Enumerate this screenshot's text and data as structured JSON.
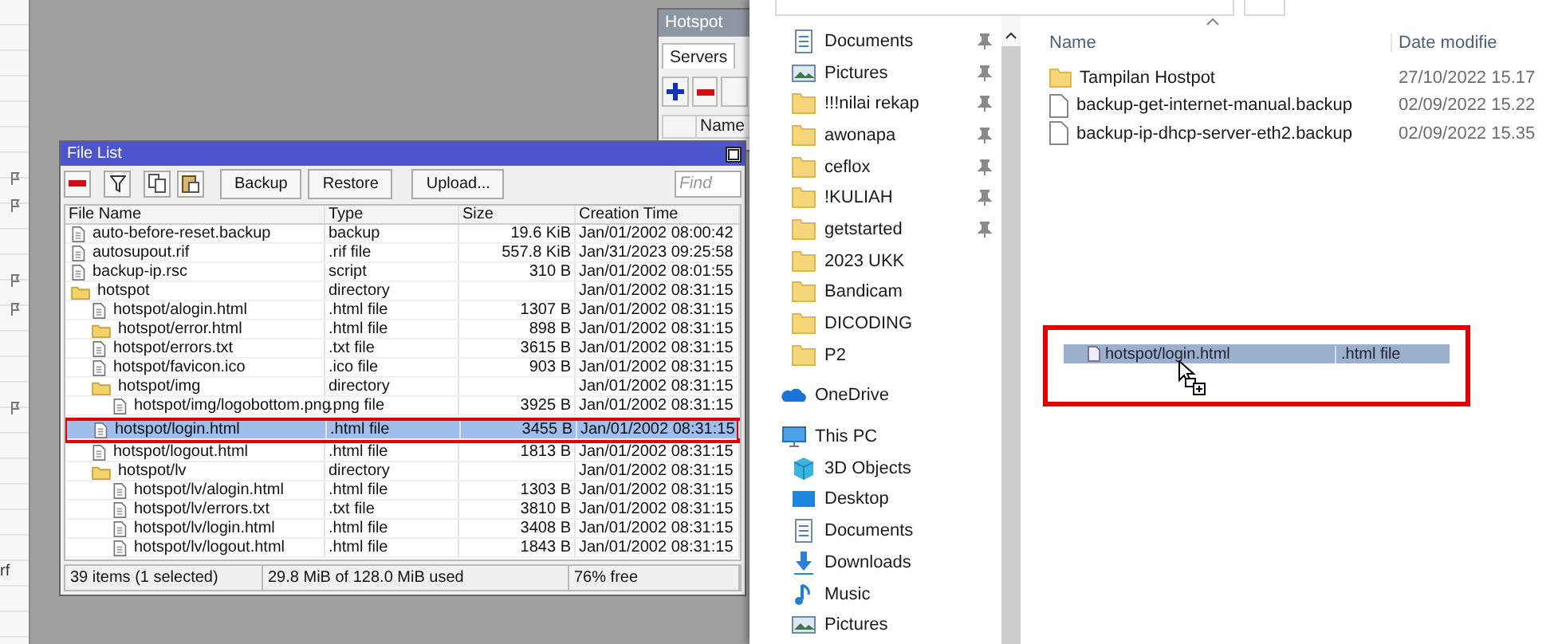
{
  "winbox": {
    "side_strip": {
      "fragment": "rf"
    },
    "hotspot_window": {
      "title": "Hotspot",
      "tabs": [
        {
          "label": "Servers",
          "selected": true
        }
      ],
      "columns": [
        "Name"
      ]
    },
    "file_list": {
      "title": "File List",
      "buttons": [
        "Backup",
        "Restore",
        "Upload..."
      ],
      "find": {
        "placeholder": "Find"
      },
      "columns": [
        "File Name",
        "Type",
        "Size",
        "Creation Time"
      ],
      "rows": [
        {
          "kind": "file",
          "name": "auto-before-reset.backup",
          "type": "backup",
          "size": "19.6 KiB",
          "created": "Jan/01/2002 08:00:42",
          "selected": false
        },
        {
          "kind": "file",
          "name": "autosupout.rif",
          "type": ".rif file",
          "size": "557.8 KiB",
          "created": "Jan/31/2023 09:25:58",
          "selected": false
        },
        {
          "kind": "file",
          "name": "backup-ip.rsc",
          "type": "script",
          "size": "310 B",
          "created": "Jan/01/2002 08:01:55",
          "selected": false
        },
        {
          "kind": "folder",
          "name": "hotspot",
          "type": "directory",
          "created": "Jan/01/2002 08:31:15",
          "selected": false,
          "children": [
            {
              "kind": "file",
              "name": "hotspot/alogin.html",
              "type": ".html file",
              "size": "1307 B",
              "created": "Jan/01/2002 08:31:15",
              "selected": false
            },
            {
              "kind": "folder",
              "name": "hotspot/error.html",
              "type": ".html file",
              "size": "898 B",
              "created": "Jan/01/2002 08:31:15",
              "selected": false
            },
            {
              "kind": "file",
              "name": "hotspot/errors.txt",
              "type": ".txt file",
              "size": "3615 B",
              "created": "Jan/01/2002 08:31:15",
              "selected": false
            },
            {
              "kind": "file",
              "name": "hotspot/favicon.ico",
              "type": ".ico file",
              "size": "903 B",
              "created": "Jan/01/2002 08:31:15",
              "selected": false
            },
            {
              "kind": "folder",
              "name": "hotspot/img",
              "type": "directory",
              "created": "Jan/01/2002 08:31:15",
              "selected": false,
              "children": [
                {
                  "kind": "file",
                  "name": "hotspot/img/logobottom.png",
                  "type": ".png file",
                  "size": "3925 B",
                  "created": "Jan/01/2002 08:31:15",
                  "selected": false
                }
              ]
            },
            {
              "kind": "file",
              "name": "hotspot/login.html",
              "type": ".html file",
              "size": "3455 B",
              "created": "Jan/01/2002 08:31:15",
              "selected": true
            },
            {
              "kind": "file",
              "name": "hotspot/logout.html",
              "type": ".html file",
              "size": "1813 B",
              "created": "Jan/01/2002 08:31:15",
              "selected": false
            },
            {
              "kind": "folder",
              "name": "hotspot/lv",
              "type": "directory",
              "created": "Jan/01/2002 08:31:15",
              "selected": false,
              "children": [
                {
                  "kind": "file",
                  "name": "hotspot/lv/alogin.html",
                  "type": ".html file",
                  "size": "1303 B",
                  "created": "Jan/01/2002 08:31:15",
                  "selected": false
                },
                {
                  "kind": "file",
                  "name": "hotspot/lv/errors.txt",
                  "type": ".txt file",
                  "size": "3810 B",
                  "created": "Jan/01/2002 08:31:15",
                  "selected": false
                },
                {
                  "kind": "file",
                  "name": "hotspot/lv/login.html",
                  "type": ".html file",
                  "size": "3408 B",
                  "created": "Jan/01/2002 08:31:15",
                  "selected": false
                },
                {
                  "kind": "file",
                  "name": "hotspot/lv/logout.html",
                  "type": ".html file",
                  "size": "1843 B",
                  "created": "Jan/01/2002 08:31:15",
                  "selected": false
                }
              ]
            }
          ]
        }
      ],
      "status_bar": [
        "39 items (1 selected)",
        "29.8 MiB of 128.0 MiB used",
        "76% free"
      ]
    }
  },
  "explorer": {
    "nav": [
      {
        "kind": "documents",
        "label": "Documents",
        "pinned": true
      },
      {
        "kind": "pictures",
        "label": "Pictures",
        "pinned": true
      },
      {
        "kind": "folder",
        "label": "!!!nilai rekap",
        "pinned": true
      },
      {
        "kind": "folder",
        "label": "awonapa",
        "pinned": true
      },
      {
        "kind": "folder",
        "label": "ceflox",
        "pinned": true
      },
      {
        "kind": "folder",
        "label": "!KULIAH",
        "pinned": true
      },
      {
        "kind": "folder",
        "label": "getstarted",
        "pinned": true
      },
      {
        "kind": "folder",
        "label": "2023 UKK",
        "pinned": false
      },
      {
        "kind": "folder",
        "label": "Bandicam",
        "pinned": false
      },
      {
        "kind": "folder",
        "label": "DICODING",
        "pinned": false
      },
      {
        "kind": "folder",
        "label": "P2",
        "pinned": false
      },
      {
        "kind": "onedrive",
        "label": "OneDrive",
        "pinned": false
      },
      {
        "kind": "pc",
        "label": "This PC",
        "pinned": false,
        "children": [
          {
            "kind": "cube",
            "label": "3D Objects",
            "pinned": false
          },
          {
            "kind": "desktop",
            "label": "Desktop",
            "pinned": false
          },
          {
            "kind": "documents",
            "label": "Documents",
            "pinned": false
          },
          {
            "kind": "downloads",
            "label": "Downloads",
            "pinned": false
          },
          {
            "kind": "music",
            "label": "Music",
            "pinned": false
          },
          {
            "kind": "pictures",
            "label": "Pictures",
            "pinned": false
          }
        ]
      }
    ],
    "columns": [
      "Name",
      "Date modifie"
    ],
    "files": [
      {
        "kind": "folder",
        "name": "Tampilan Hostpot",
        "date": "27/10/2022 15.17"
      },
      {
        "kind": "file",
        "name": "backup-get-internet-manual.backup",
        "date": "02/09/2022 15.22"
      },
      {
        "kind": "file",
        "name": "backup-ip-dhcp-server-eth2.backup",
        "date": "02/09/2022 15.35"
      }
    ],
    "drag_ghost": {
      "name": "hotspot/login.html",
      "type": ".html file"
    }
  }
}
